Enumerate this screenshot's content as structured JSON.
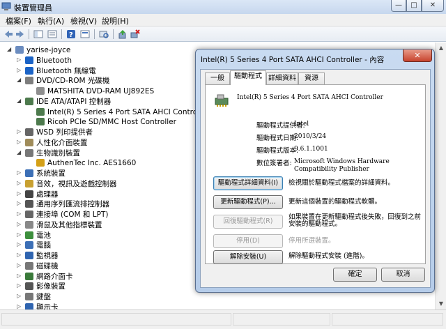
{
  "window": {
    "title": "裝置管理員",
    "min": "—",
    "max": "□",
    "close": "✕"
  },
  "menu": [
    {
      "label": "檔案(F)"
    },
    {
      "label": "執行(A)"
    },
    {
      "label": "檢視(V)"
    },
    {
      "label": "說明(H)"
    }
  ],
  "toolbar": {
    "icons": [
      "back-icon",
      "forward-icon",
      "tree-view-icon",
      "properties-view-icon",
      "help-icon",
      "details-icon",
      "scan-icon",
      "update-driver-icon",
      "uninstall-icon"
    ]
  },
  "tree": {
    "nodes": [
      {
        "label": "yarise-joyce",
        "level": 0,
        "expander": "◢",
        "icon_color": "#6b8cbf"
      },
      {
        "label": "Bluetooth",
        "level": 1,
        "expander": "▷",
        "icon_color": "#1b63c6"
      },
      {
        "label": "Bluetooth 無線電",
        "level": 1,
        "expander": "▷",
        "icon_color": "#1b63c6"
      },
      {
        "label": "DVD/CD-ROM 光碟機",
        "level": 1,
        "expander": "◢",
        "icon_color": "#7d7d7d"
      },
      {
        "label": "MATSHITA DVD-RAM UJ892ES",
        "level": 2,
        "expander": "",
        "icon_color": "#8e8e8e"
      },
      {
        "label": "IDE ATA/ATAPI 控制器",
        "level": 1,
        "expander": "◢",
        "icon_color": "#4d7a4d"
      },
      {
        "label": "Intel(R) 5 Series 4 Port SATA AHCI Controller",
        "level": 2,
        "expander": "",
        "icon_color": "#4d7a4d"
      },
      {
        "label": "Ricoh PCIe SD/MMC Host Controller",
        "level": 2,
        "expander": "",
        "icon_color": "#4d7a4d"
      },
      {
        "label": "WSD 列印提供者",
        "level": 1,
        "expander": "▷",
        "icon_color": "#666666"
      },
      {
        "label": "人性化介面裝置",
        "level": 1,
        "expander": "▷",
        "icon_color": "#a08c5a"
      },
      {
        "label": "生物識別裝置",
        "level": 1,
        "expander": "◢",
        "icon_color": "#777777"
      },
      {
        "label": "AuthenTec Inc. AES1660",
        "level": 2,
        "expander": "",
        "icon_color": "#d4a017"
      },
      {
        "label": "系統裝置",
        "level": 1,
        "expander": "▷",
        "icon_color": "#3c6fb6"
      },
      {
        "label": "音效，視訊及遊戲控制器",
        "level": 1,
        "expander": "▷",
        "icon_color": "#c8a030"
      },
      {
        "label": "處理器",
        "level": 1,
        "expander": "▷",
        "icon_color": "#444444"
      },
      {
        "label": "通用序列匯流排控制器",
        "level": 1,
        "expander": "▷",
        "icon_color": "#555555"
      },
      {
        "label": "連接埠 (COM 和 LPT)",
        "level": 1,
        "expander": "▷",
        "icon_color": "#666666"
      },
      {
        "label": "滑鼠及其他指標裝置",
        "level": 1,
        "expander": "▷",
        "icon_color": "#888888"
      },
      {
        "label": "電池",
        "level": 1,
        "expander": "▷",
        "icon_color": "#3d8f3d"
      },
      {
        "label": "電腦",
        "level": 1,
        "expander": "▷",
        "icon_color": "#3c6fb6"
      },
      {
        "label": "監視器",
        "level": 1,
        "expander": "▷",
        "icon_color": "#2f64b0"
      },
      {
        "label": "磁碟機",
        "level": 1,
        "expander": "▷",
        "icon_color": "#777777"
      },
      {
        "label": "網路介面卡",
        "level": 1,
        "expander": "▷",
        "icon_color": "#3a7a3a"
      },
      {
        "label": "影像裝置",
        "level": 1,
        "expander": "▷",
        "icon_color": "#555555"
      },
      {
        "label": "鍵盤",
        "level": 1,
        "expander": "▷",
        "icon_color": "#777777"
      },
      {
        "label": "顯示卡",
        "level": 1,
        "expander": "▷",
        "icon_color": "#2f64b0"
      }
    ]
  },
  "dialog": {
    "title": "Intel(R) 5 Series 4 Port SATA AHCI Controller - 內容",
    "close": "✕",
    "tabs": [
      {
        "label": "一般"
      },
      {
        "label": "驅動程式",
        "active": true
      },
      {
        "label": "詳細資料"
      },
      {
        "label": "資源"
      }
    ],
    "device_name": "Intel(R) 5 Series 4 Port SATA AHCI Controller",
    "props": [
      {
        "label": "驅動程式提供者:",
        "value": "Intel"
      },
      {
        "label": "驅動程式日期:",
        "value": "2010/3/24"
      },
      {
        "label": "驅動程式版本:",
        "value": "9.6.1.1001"
      },
      {
        "label": "數位簽署者:",
        "value": "Microsoft Windows Hardware Compatibility Publisher"
      }
    ],
    "actions": [
      {
        "button": "驅動程式詳細資料(I)",
        "desc": "檢視關於驅動程式檔案的詳細資料。",
        "enabled": true
      },
      {
        "button": "更新驅動程式(P)...",
        "desc": "更新這個裝置的驅動程式軟體。",
        "enabled": true
      },
      {
        "button": "回復驅動程式(R)",
        "desc": "如果裝置在更新驅動程式後失敗，回復到之前安裝的驅動程式。",
        "enabled": false
      },
      {
        "button": "停用(D)",
        "desc": "停用所選裝置。",
        "enabled": false
      },
      {
        "button": "解除安裝(U)",
        "desc": "解除驅動程式安裝 (進階)。",
        "enabled": true
      }
    ],
    "ok": "確定",
    "cancel": "取消"
  }
}
